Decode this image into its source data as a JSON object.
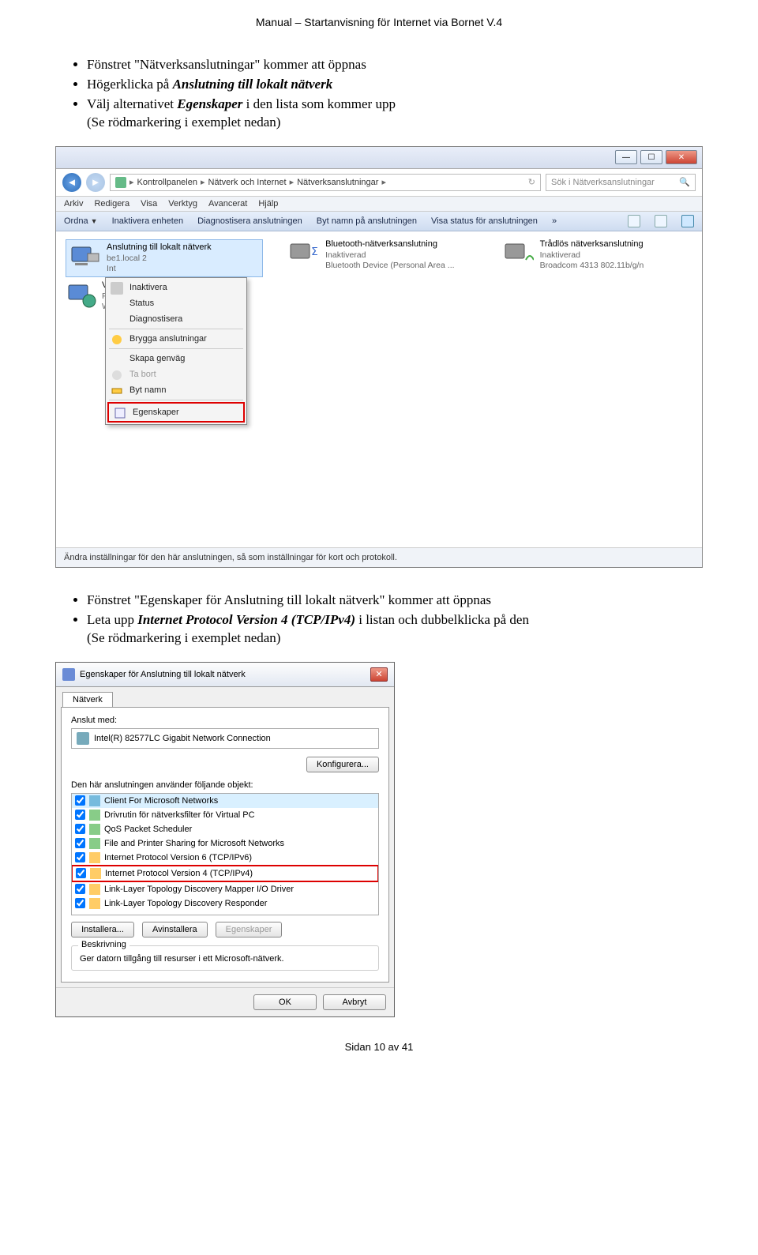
{
  "header": "Manual – Startanvisning för Internet via Bornet  V.4",
  "bullets1": {
    "b1a": "Fönstret \"Nätverksanslutningar\" kommer att öppnas",
    "b2a": "Högerklicka på ",
    "b2b": "Anslutning till lokalt nätverk",
    "b3a": "Välj alternativet ",
    "b3b": "Egenskaper",
    "b3c": " i den lista som kommer upp",
    "b4": "(Se rödmarkering i exemplet nedan)"
  },
  "win1": {
    "crumb1": "Kontrollpanelen",
    "crumb2": "Nätverk och Internet",
    "crumb3": "Nätverksanslutningar",
    "searchPlaceholder": "Sök i Nätverksanslutningar",
    "menu": [
      "Arkiv",
      "Redigera",
      "Visa",
      "Verktyg",
      "Avancerat",
      "Hjälp"
    ],
    "toolbar": {
      "t1": "Ordna",
      "t2": "Inaktivera enheten",
      "t3": "Diagnostisera anslutningen",
      "t4": "Byt namn på anslutningen",
      "t5": "Visa status för anslutningen"
    },
    "net1": {
      "t": "Anslutning till lokalt nätverk",
      "s1": "be1.local 2",
      "s2": "Int"
    },
    "net2": {
      "t": "Bluetooth-nätverksanslutning",
      "s1": "Inaktiverad",
      "s2": "Bluetooth Device (Personal Area ..."
    },
    "net3": {
      "t": "Trådlös nätverksanslutning",
      "s1": "Inaktiverad",
      "s2": "Broadcom 4313 802.11b/g/n"
    },
    "row2a": "VP",
    "row2b": "Frå",
    "row2c": "WA",
    "ctx": {
      "m1": "Inaktivera",
      "m2": "Status",
      "m3": "Diagnostisera",
      "m4": "Brygga anslutningar",
      "m5": "Skapa genväg",
      "m6": "Ta bort",
      "m7": "Byt namn",
      "m8": "Egenskaper"
    },
    "status": "Ändra inställningar för den här anslutningen, så som inställningar för kort och protokoll."
  },
  "bullets2": {
    "b1": "Fönstret \"Egenskaper för Anslutning till lokalt nätverk\" kommer att öppnas",
    "b2a": "Leta upp ",
    "b2b": "Internet Protocol Version 4 (TCP/IPv4)",
    "b2c": " i listan och dubbelklicka på den",
    "b3": "(Se rödmarkering i exemplet nedan)"
  },
  "dlg": {
    "title": "Egenskaper för Anslutning till lokalt nätverk",
    "tab": "Nätverk",
    "connectWith": "Anslut med:",
    "adapter": "Intel(R) 82577LC Gigabit Network Connection",
    "configure": "Konfigurera...",
    "usesLabel": "Den här anslutningen använder följande objekt:",
    "items": [
      "Client For Microsoft Networks",
      "Drivrutin för nätverksfilter för Virtual PC",
      "QoS Packet Scheduler",
      "File and Printer Sharing for Microsoft Networks",
      "Internet Protocol Version 6 (TCP/IPv6)",
      "Internet Protocol Version 4 (TCP/IPv4)",
      "Link-Layer Topology Discovery Mapper I/O Driver",
      "Link-Layer Topology Discovery Responder"
    ],
    "install": "Installera...",
    "uninstall": "Avinstallera",
    "properties": "Egenskaper",
    "descLabel": "Beskrivning",
    "descText": "Ger datorn tillgång till resurser i ett Microsoft-nätverk.",
    "ok": "OK",
    "cancel": "Avbryt"
  },
  "footer": "Sidan 10 av 41"
}
